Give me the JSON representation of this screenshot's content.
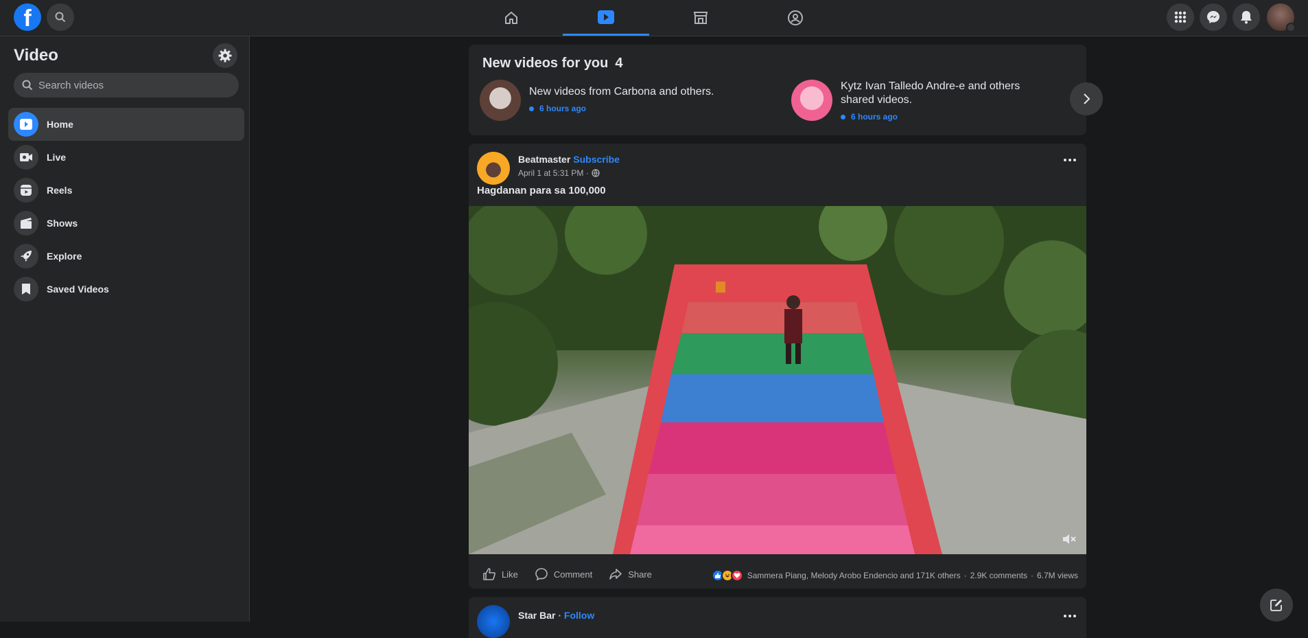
{
  "topbar": {
    "logo": "f",
    "nav": [
      {
        "icon": "home-icon",
        "active": false
      },
      {
        "icon": "watch-icon",
        "active": true
      },
      {
        "icon": "marketplace-icon",
        "active": false
      },
      {
        "icon": "groups-icon",
        "active": false
      }
    ],
    "right_icons": [
      "menu-grid-icon",
      "messenger-icon",
      "notifications-icon"
    ]
  },
  "sidebar": {
    "title": "Video",
    "search_placeholder": "Search videos",
    "items": [
      {
        "label": "Home",
        "icon": "video-home-icon",
        "active": true
      },
      {
        "label": "Live",
        "icon": "live-icon",
        "active": false
      },
      {
        "label": "Reels",
        "icon": "reels-icon",
        "active": false
      },
      {
        "label": "Shows",
        "icon": "shows-icon",
        "active": false
      },
      {
        "label": "Explore",
        "icon": "explore-icon",
        "active": false
      },
      {
        "label": "Saved Videos",
        "icon": "saved-icon",
        "active": false
      }
    ]
  },
  "new_videos": {
    "title": "New videos for you",
    "count": "4",
    "items": [
      {
        "text": "New videos from Carbona and others.",
        "time": "6 hours ago"
      },
      {
        "text": "Kytz Ivan Talledo Andre-e and others shared videos.",
        "time": "6 hours ago"
      }
    ]
  },
  "post": {
    "author": "Beatmaster",
    "action": "Subscribe",
    "meta": "April 1 at 5:31 PM ·",
    "caption": "Hagdanan para sa 100,000",
    "actions": {
      "like": "Like",
      "comment": "Comment",
      "share": "Share"
    },
    "reactions_text": "Sammera Piang, Melody Arobo Endencio and 171K others",
    "comments": "2.9K comments",
    "views": "6.7M views",
    "sep": "·"
  },
  "post2": {
    "author": "Star Bar",
    "sep": "·",
    "action": "Follow"
  },
  "colors": {
    "accent": "#2d88ff",
    "brand": "#1877f2",
    "background": "#18191a",
    "card": "#242526"
  }
}
